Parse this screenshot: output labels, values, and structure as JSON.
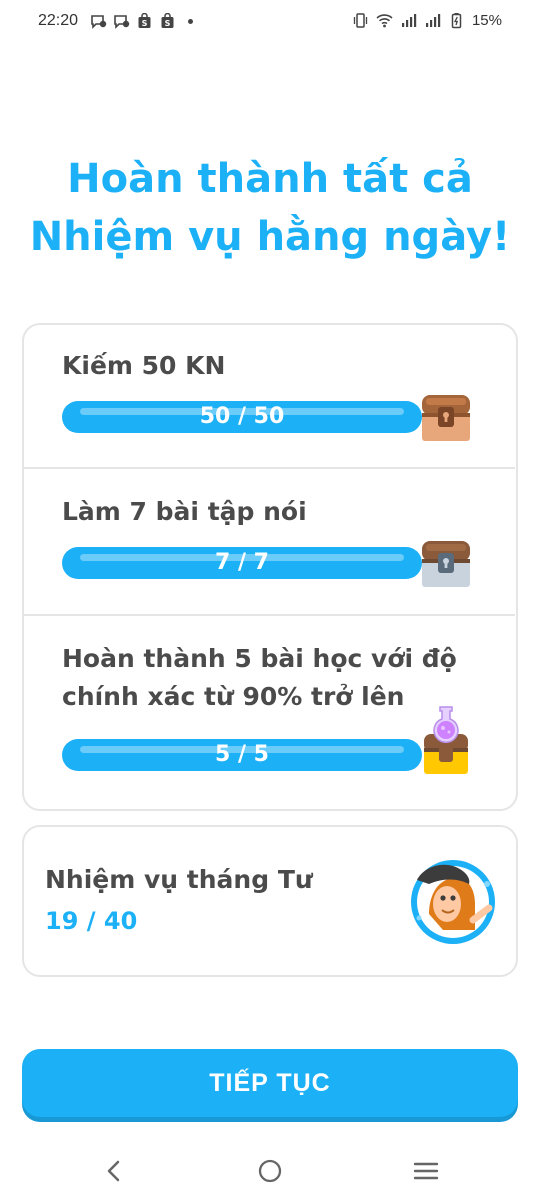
{
  "status_bar": {
    "time": "22:20",
    "battery": "15%",
    "notification_icons": [
      "message-icon",
      "message-icon",
      "shop-icon",
      "shop-icon"
    ],
    "system_icons": [
      "vibrate-icon",
      "wifi-icon",
      "signal-icon",
      "signal-icon",
      "battery-icon"
    ]
  },
  "headline": {
    "line1": "Hoàn thành tất cả",
    "line2": "Nhiệm vụ hằng ngày!"
  },
  "quests": [
    {
      "title": "Kiếm 50 KN",
      "progress_text": "50 / 50",
      "progress": 1.0,
      "chest": "brown-chest-icon"
    },
    {
      "title": "Làm 7 bài tập nói",
      "progress_text": "7 / 7",
      "progress": 1.0,
      "chest": "silver-chest-icon"
    },
    {
      "title_line1": "Hoàn thành 5 bài học với độ",
      "title_line2": "chính xác từ 90% trở lên",
      "progress_text": "5 / 5",
      "progress": 1.0,
      "chest": "gold-chest-potion-icon"
    }
  ],
  "monthly": {
    "title": "Nhiệm vụ tháng Tư",
    "progress": "19 / 40",
    "badge": "character-badge-icon"
  },
  "continue_button": "TIẾP TỤC",
  "colors": {
    "accent": "#1cb0f6",
    "accent_dark": "#1899d6",
    "border": "#e5e5e5",
    "text": "#4b4b4b"
  },
  "nav": [
    "back-icon",
    "home-icon",
    "menu-icon"
  ]
}
